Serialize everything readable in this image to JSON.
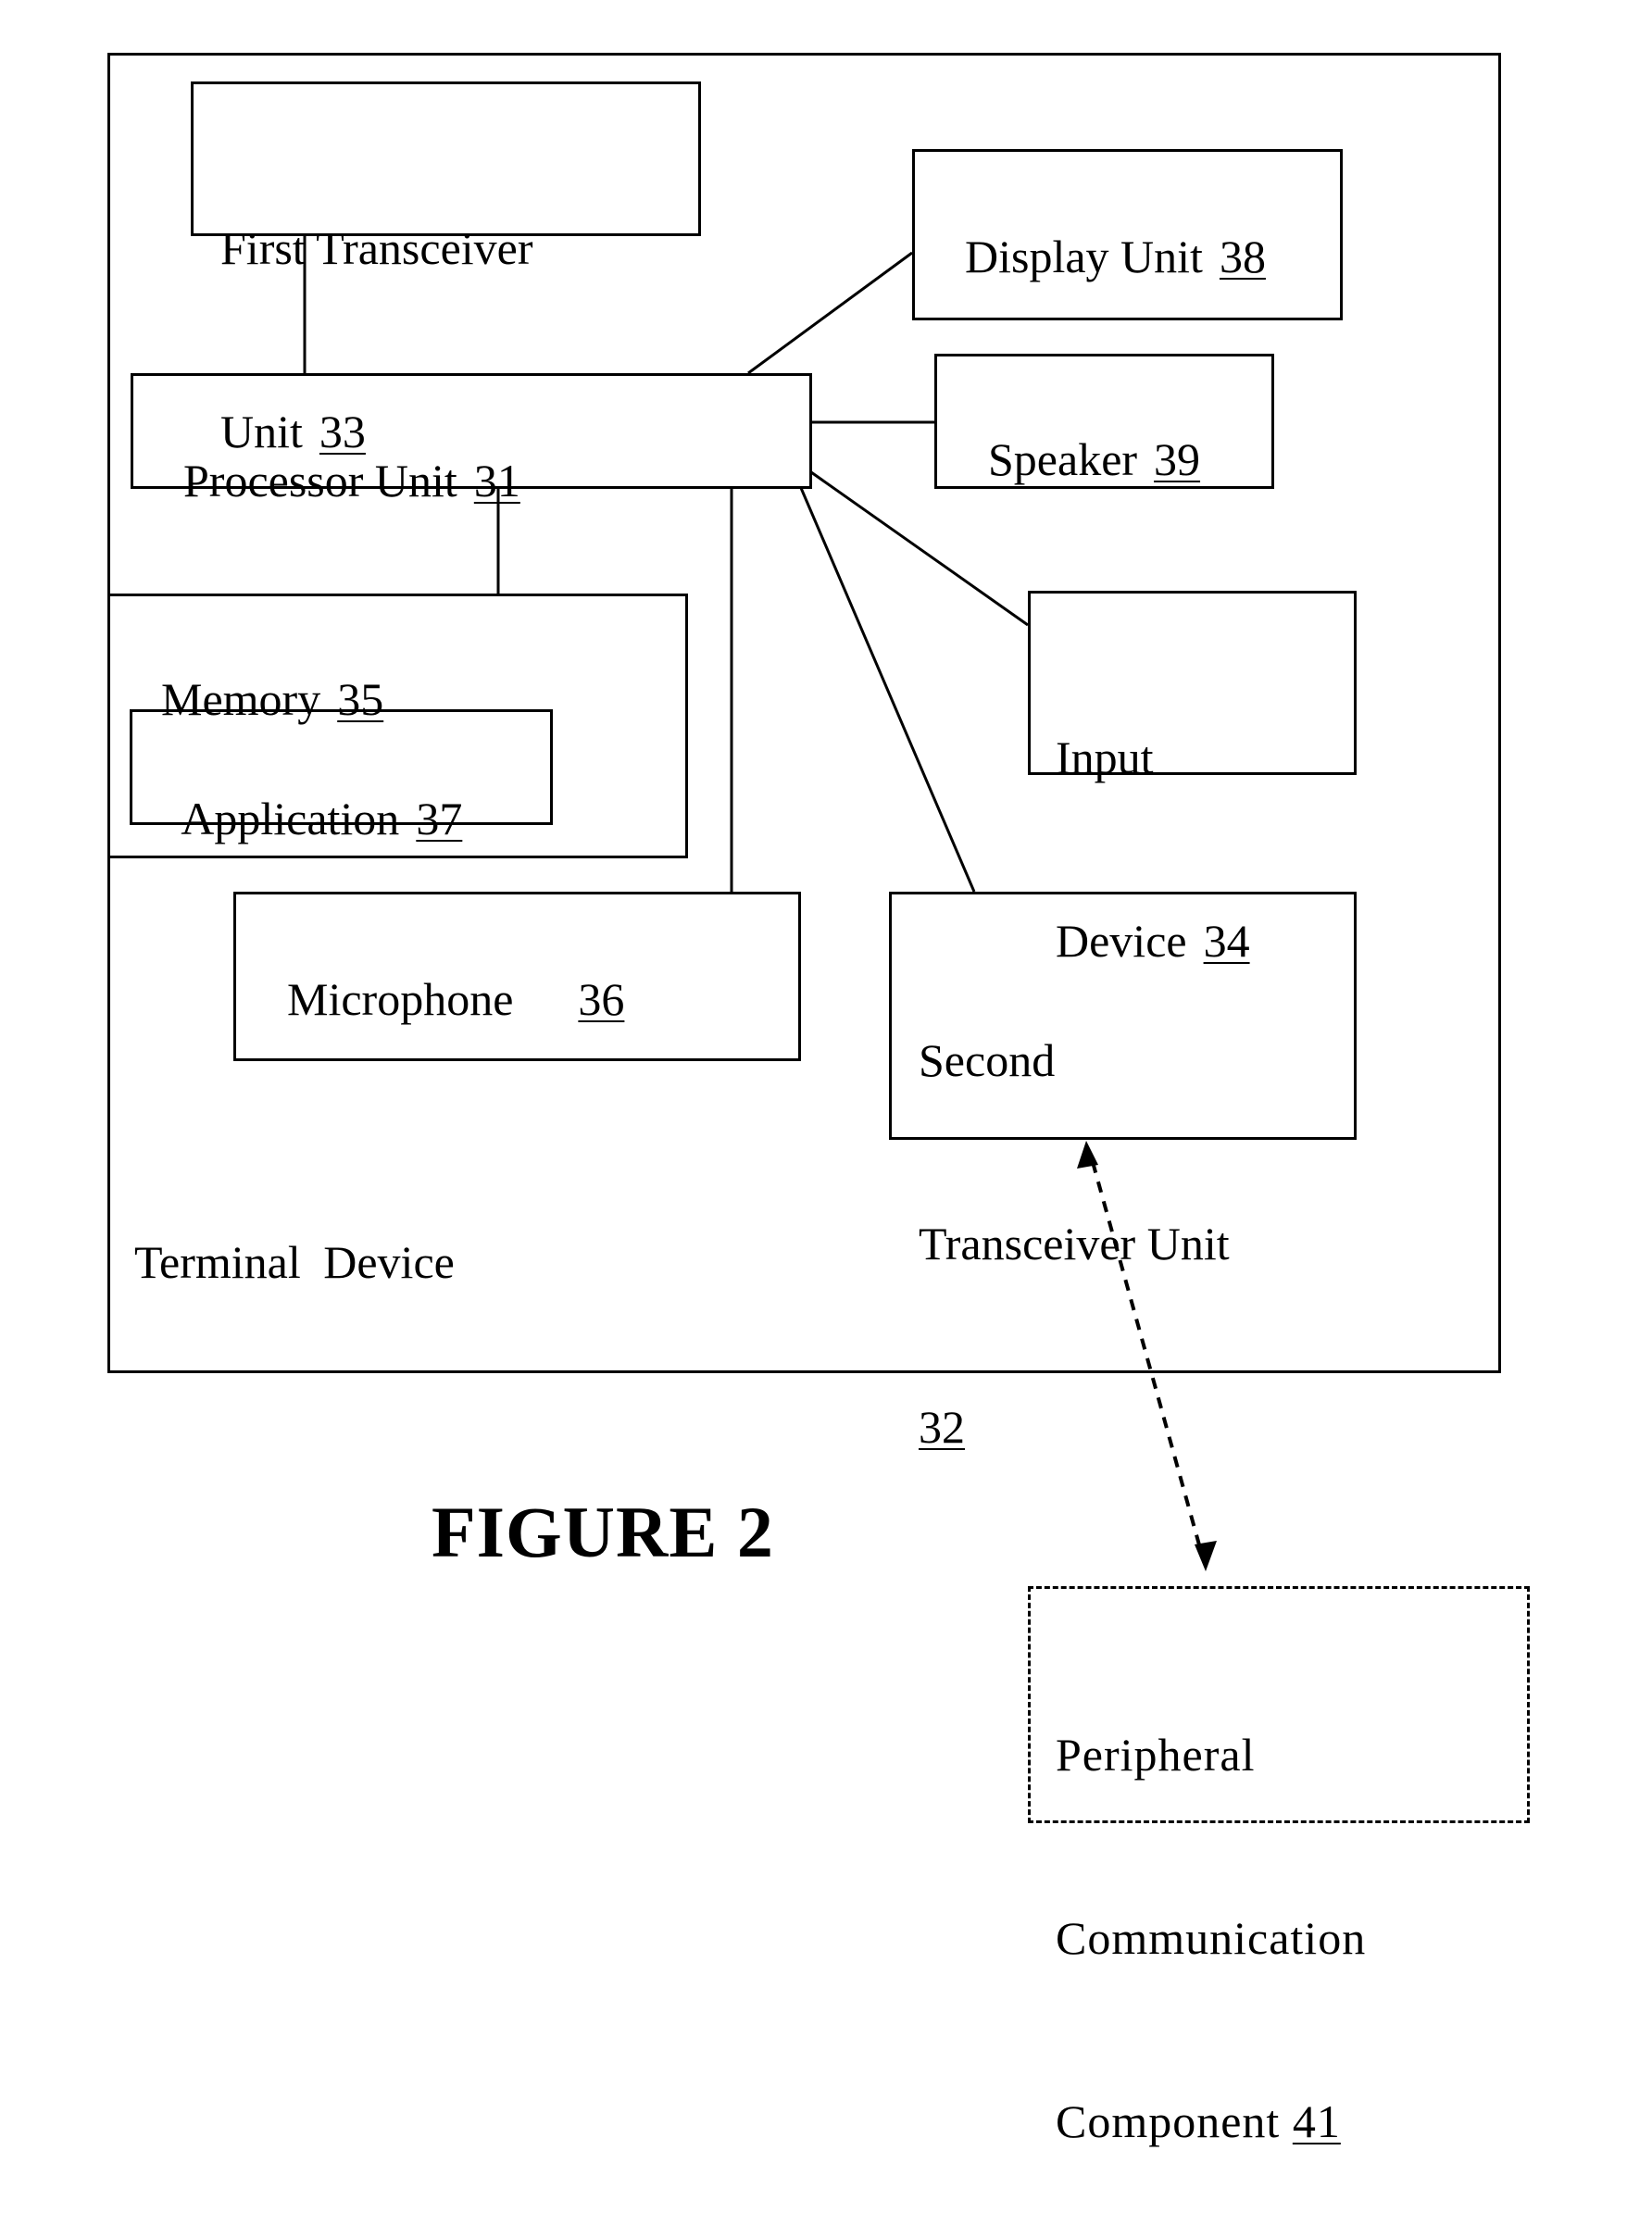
{
  "figure": {
    "title": "FIGURE 2",
    "container_label": "Terminal Device"
  },
  "components": {
    "first_transceiver": {
      "line1": "First Transceiver",
      "line2": "Unit",
      "ref": "33"
    },
    "display": {
      "name": "Display Unit",
      "ref": "38"
    },
    "processor": {
      "name": "Processor Unit",
      "ref": "31"
    },
    "speaker": {
      "name": "Speaker",
      "ref": "39"
    },
    "memory": {
      "name": "Memory",
      "ref": "35"
    },
    "application": {
      "name": "Application",
      "ref": "37"
    },
    "input_device": {
      "line1": "Input",
      "line2": "Device",
      "ref": "34"
    },
    "microphone": {
      "name": "Microphone",
      "ref": "36"
    },
    "second_transceiver": {
      "line1": "Second",
      "line2": "Transceiver Unit",
      "ref": "32"
    },
    "peripheral": {
      "line1": "Peripheral",
      "line2": "Communication",
      "line3": "Component",
      "ref": "41"
    }
  },
  "connections": [
    {
      "from": "processor",
      "to": "first_transceiver",
      "style": "solid"
    },
    {
      "from": "processor",
      "to": "display",
      "style": "solid"
    },
    {
      "from": "processor",
      "to": "speaker",
      "style": "solid"
    },
    {
      "from": "processor",
      "to": "input_device",
      "style": "solid"
    },
    {
      "from": "processor",
      "to": "second_transceiver",
      "style": "solid"
    },
    {
      "from": "processor",
      "to": "memory",
      "style": "solid"
    },
    {
      "from": "processor",
      "to": "microphone",
      "style": "solid"
    },
    {
      "from": "second_transceiver",
      "to": "peripheral",
      "style": "dashed-bidirectional"
    }
  ]
}
